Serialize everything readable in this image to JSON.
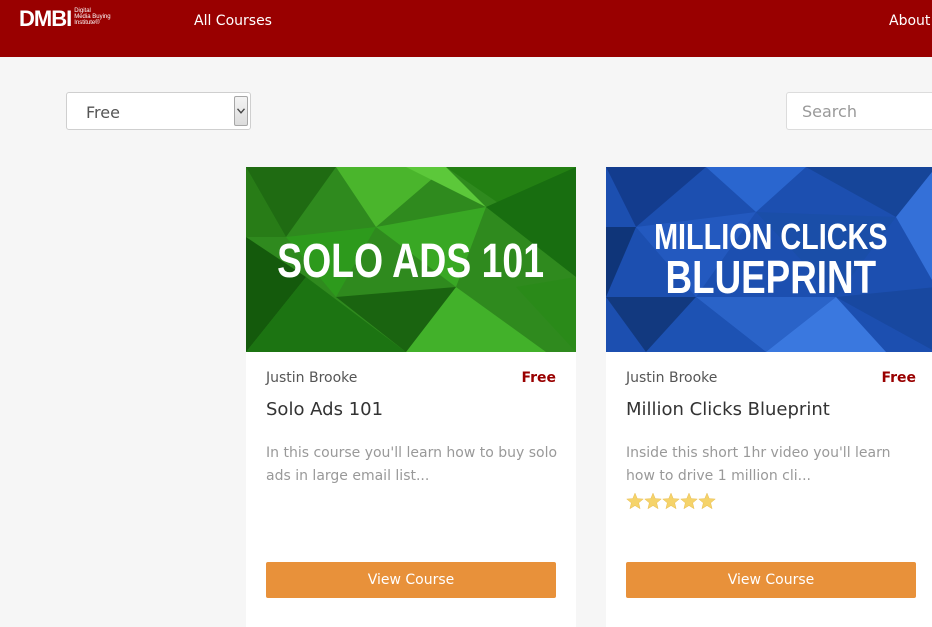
{
  "nav": {
    "logo_text": "DMBI",
    "logo_tagline": [
      "Digital",
      "Media Buying",
      "Institute®"
    ],
    "courses_link": "All Courses",
    "about_link": "About"
  },
  "filter": {
    "selected": "Free"
  },
  "search": {
    "placeholder": "Search"
  },
  "courses": [
    {
      "image_text": [
        "SOLO ADS 101"
      ],
      "author": "Justin Brooke",
      "price": "Free",
      "title": "Solo Ads 101",
      "description": "In this course you'll learn how to buy solo ads in large email list...",
      "rating": null,
      "button": "View Course"
    },
    {
      "image_text": [
        "MILLION CLICKS",
        "BLUEPRINT"
      ],
      "author": "Justin Brooke",
      "price": "Free",
      "title": "Million Clicks Blueprint",
      "description": "Inside this short 1hr video you'll learn how to drive 1 million cli...",
      "rating": 5,
      "button": "View Course"
    }
  ],
  "colors": {
    "nav": "#990000",
    "accent": "#e8913a",
    "price": "#990000",
    "star": "#f5d36a"
  }
}
